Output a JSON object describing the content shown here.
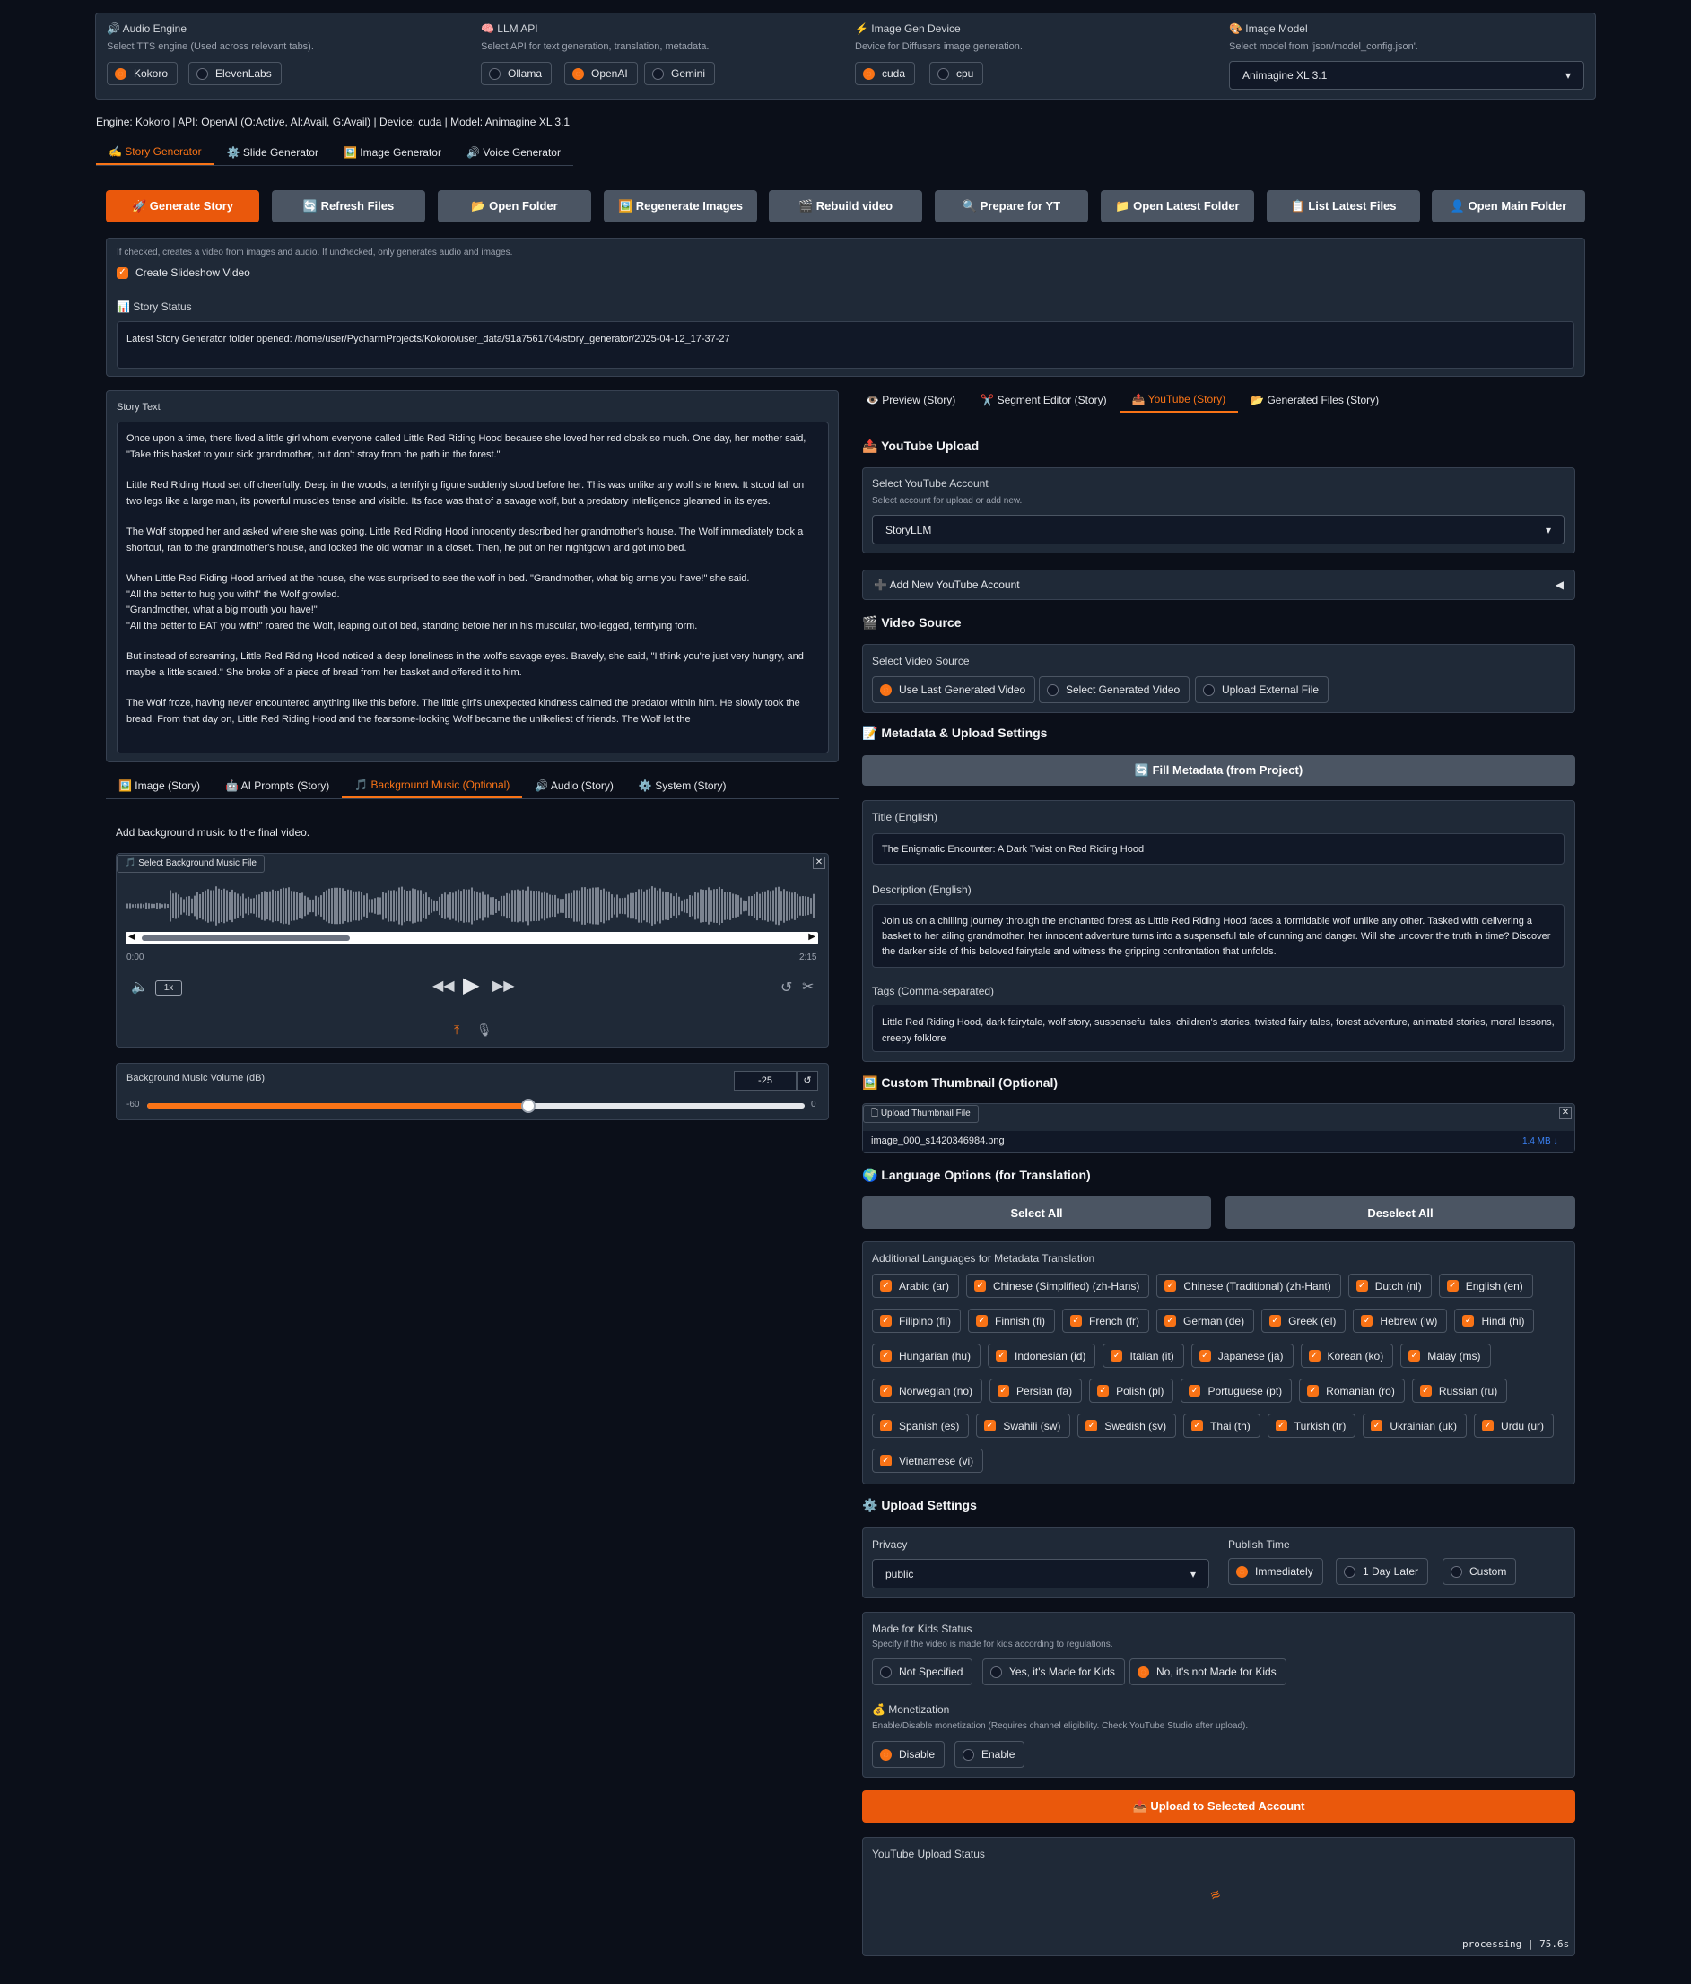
{
  "top": {
    "audio_engine": {
      "title": "🔊 Audio Engine",
      "sub": "Select TTS engine (Used across relevant tabs).",
      "options": [
        "Kokoro",
        "ElevenLabs"
      ],
      "selected": "Kokoro"
    },
    "llm_api": {
      "title": "🧠 LLM API",
      "sub": "Select API for text generation, translation, metadata.",
      "options": [
        "Ollama",
        "OpenAI",
        "Gemini"
      ],
      "selected": "OpenAI"
    },
    "device": {
      "title": "⚡ Image Gen Device",
      "sub": "Device for Diffusers image generation.",
      "options": [
        "cuda",
        "cpu"
      ],
      "selected": "cuda"
    },
    "image_model": {
      "title": "🎨 Image Model",
      "sub": "Select model from 'json/model_config.json'.",
      "value": "Animagine XL 3.1"
    }
  },
  "status_line": "Engine: Kokoro | API: OpenAI (O:Active, AI:Avail, G:Avail) | Device: cuda | Model: Animagine XL 3.1",
  "main_tabs": [
    "✍️ Story Generator",
    "⚙️ Slide Generator",
    "🖼️ Image Generator",
    "🔊 Voice Generator"
  ],
  "actions": [
    "🚀 Generate Story",
    "🔄 Refresh Files",
    "📂 Open Folder",
    "🖼️ Regenerate Images",
    "🎬 Rebuild video",
    "🔍 Prepare for YT",
    "📁 Open Latest Folder",
    "📋 List Latest Files",
    "👤 Open Main Folder"
  ],
  "slideshow": {
    "info": "If checked, creates a video from images and audio. If unchecked, only generates audio and images.",
    "label": "Create Slideshow Video"
  },
  "story_status": {
    "label": "📊 Story Status",
    "value": "Latest Story Generator folder opened: /home/user/PycharmProjects/Kokoro/user_data/91a7561704/story_generator/2025-04-12_17-37-27"
  },
  "story_text": {
    "label": "Story Text",
    "paragraphs": [
      "Once upon a time, there lived a little girl whom everyone called Little Red Riding Hood because she loved her red cloak so much. One day, her mother said, \"Take this basket to your sick grandmother, but don't stray from the path in the forest.\"",
      "Little Red Riding Hood set off cheerfully. Deep in the woods, a terrifying figure suddenly stood before her. This was unlike any wolf she knew. It stood tall on two legs like a large man, its powerful muscles tense and visible. Its face was that of a savage wolf, but a predatory intelligence gleamed in its eyes.",
      "The Wolf stopped her and asked where she was going. Little Red Riding Hood innocently described her grandmother's house. The Wolf immediately took a shortcut, ran to the grandmother's house, and locked the old woman in a closet. Then, he put on her nightgown and got into bed.",
      "When Little Red Riding Hood arrived at the house, she was surprised to see the wolf in bed. \"Grandmother, what big arms you have!\" she said.\n\"All the better to hug you with!\" the Wolf growled.\n\"Grandmother, what a big mouth you have!\"\n\"All the better to EAT you with!\" roared the Wolf, leaping out of bed, standing before her in his muscular, two-legged, terrifying form.",
      "But instead of screaming, Little Red Riding Hood noticed a deep loneliness in the wolf's savage eyes. Bravely, she said, \"I think you're just very hungry, and maybe a little scared.\" She broke off a piece of bread from her basket and offered it to him.",
      "The Wolf froze, having never encountered anything like this before. The little girl's unexpected kindness calmed the predator within him. He slowly took the bread. From that day on, Little Red Riding Hood and the fearsome-looking Wolf became the unlikeliest of friends. The Wolf let the"
    ]
  },
  "sub_tabs": [
    "🖼️ Image (Story)",
    "🤖 AI Prompts (Story)",
    "🎵 Background Music (Optional)",
    "🔊 Audio (Story)",
    "⚙️ System (Story)"
  ],
  "bg_music": {
    "hint": "Add background music to the final video.",
    "file_label": "🎵 Select Background Music File",
    "time_start": "0:00",
    "time_end": "2:15",
    "speed": "1x",
    "volume_label": "Background Music Volume (dB)",
    "volume_value": "-25",
    "vol_min": "-60",
    "vol_max": "0",
    "volume_fraction": 0.58
  },
  "right_tabs": [
    "👁️ Preview (Story)",
    "✂️ Segment Editor (Story)",
    "📤 YouTube (Story)",
    "📂 Generated Files (Story)"
  ],
  "youtube": {
    "upload_title": "📤 YouTube Upload",
    "account_label": "Select YouTube Account",
    "account_sub": "Select account for upload or add new.",
    "account_value": "StoryLLM",
    "add_account": "➕ Add New YouTube Account",
    "video_source_title": "🎬 Video Source",
    "video_source_label": "Select Video Source",
    "video_source_options": [
      "Use Last Generated Video",
      "Select Generated Video",
      "Upload External File"
    ],
    "video_source_selected": "Use Last Generated Video",
    "metadata_title": "📝 Metadata & Upload Settings",
    "fill_btn": "🔄 Fill Metadata (from Project)",
    "title_label": "Title (English)",
    "title_value": "The Enigmatic Encounter: A Dark Twist on Red Riding Hood",
    "desc_label": "Description (English)",
    "desc_value": "Join us on a chilling journey through the enchanted forest as Little Red Riding Hood faces a formidable wolf unlike any other. Tasked with delivering a basket to her ailing grandmother, her innocent adventure turns into a suspenseful tale of cunning and danger. Will she uncover the truth in time? Discover the darker side of this beloved fairytale and witness the gripping confrontation that unfolds.",
    "tags_label": "Tags (Comma-separated)",
    "tags_value": "Little Red Riding Hood, dark fairytale, wolf story, suspenseful tales, children's stories, twisted fairy tales, forest adventure, animated stories, moral lessons, creepy folklore",
    "thumb_title": "🖼️ Custom Thumbnail (Optional)",
    "thumb_label": "Upload Thumbnail File",
    "thumb_file": "image_000_s1420346984.png",
    "thumb_size": "1.4 MB ↓",
    "lang_title": "🌍 Language Options (for Translation)",
    "select_all": "Select All",
    "deselect_all": "Deselect All",
    "lang_label": "Additional Languages for Metadata Translation",
    "languages": [
      "Arabic (ar)",
      "Chinese (Simplified) (zh-Hans)",
      "Chinese (Traditional) (zh-Hant)",
      "Dutch (nl)",
      "English (en)",
      "Filipino (fil)",
      "Finnish (fi)",
      "French (fr)",
      "German (de)",
      "Greek (el)",
      "Hebrew (iw)",
      "Hindi (hi)",
      "Hungarian (hu)",
      "Indonesian (id)",
      "Italian (it)",
      "Japanese (ja)",
      "Korean (ko)",
      "Malay (ms)",
      "Norwegian (no)",
      "Persian (fa)",
      "Polish (pl)",
      "Portuguese (pt)",
      "Romanian (ro)",
      "Russian (ru)",
      "Spanish (es)",
      "Swahili (sw)",
      "Swedish (sv)",
      "Thai (th)",
      "Turkish (tr)",
      "Ukrainian (uk)",
      "Urdu (ur)",
      "Vietnamese (vi)"
    ],
    "upload_settings_title": "⚙️ Upload Settings",
    "privacy_label": "Privacy",
    "privacy_value": "public",
    "publish_label": "Publish Time",
    "publish_options": [
      "Immediately",
      "1 Day Later",
      "Custom"
    ],
    "publish_selected": "Immediately",
    "kids_label": "Made for Kids Status",
    "kids_sub": "Specify if the video is made for kids according to regulations.",
    "kids_options": [
      "Not Specified",
      "Yes, it's Made for Kids",
      "No, it's not Made for Kids"
    ],
    "kids_selected": "No, it's not Made for Kids",
    "monet_label": "💰 Monetization",
    "monet_sub": "Enable/Disable monetization (Requires channel eligibility. Check YouTube Studio after upload).",
    "monet_options": [
      "Disable",
      "Enable"
    ],
    "monet_selected": "Disable",
    "upload_btn": "📤 Upload to Selected Account",
    "status_label": "YouTube Upload Status",
    "status_text": "processing | 75.6s"
  },
  "colors": {
    "accent": "#f97316",
    "panel": "#1f2937",
    "background": "#0b0f19"
  }
}
